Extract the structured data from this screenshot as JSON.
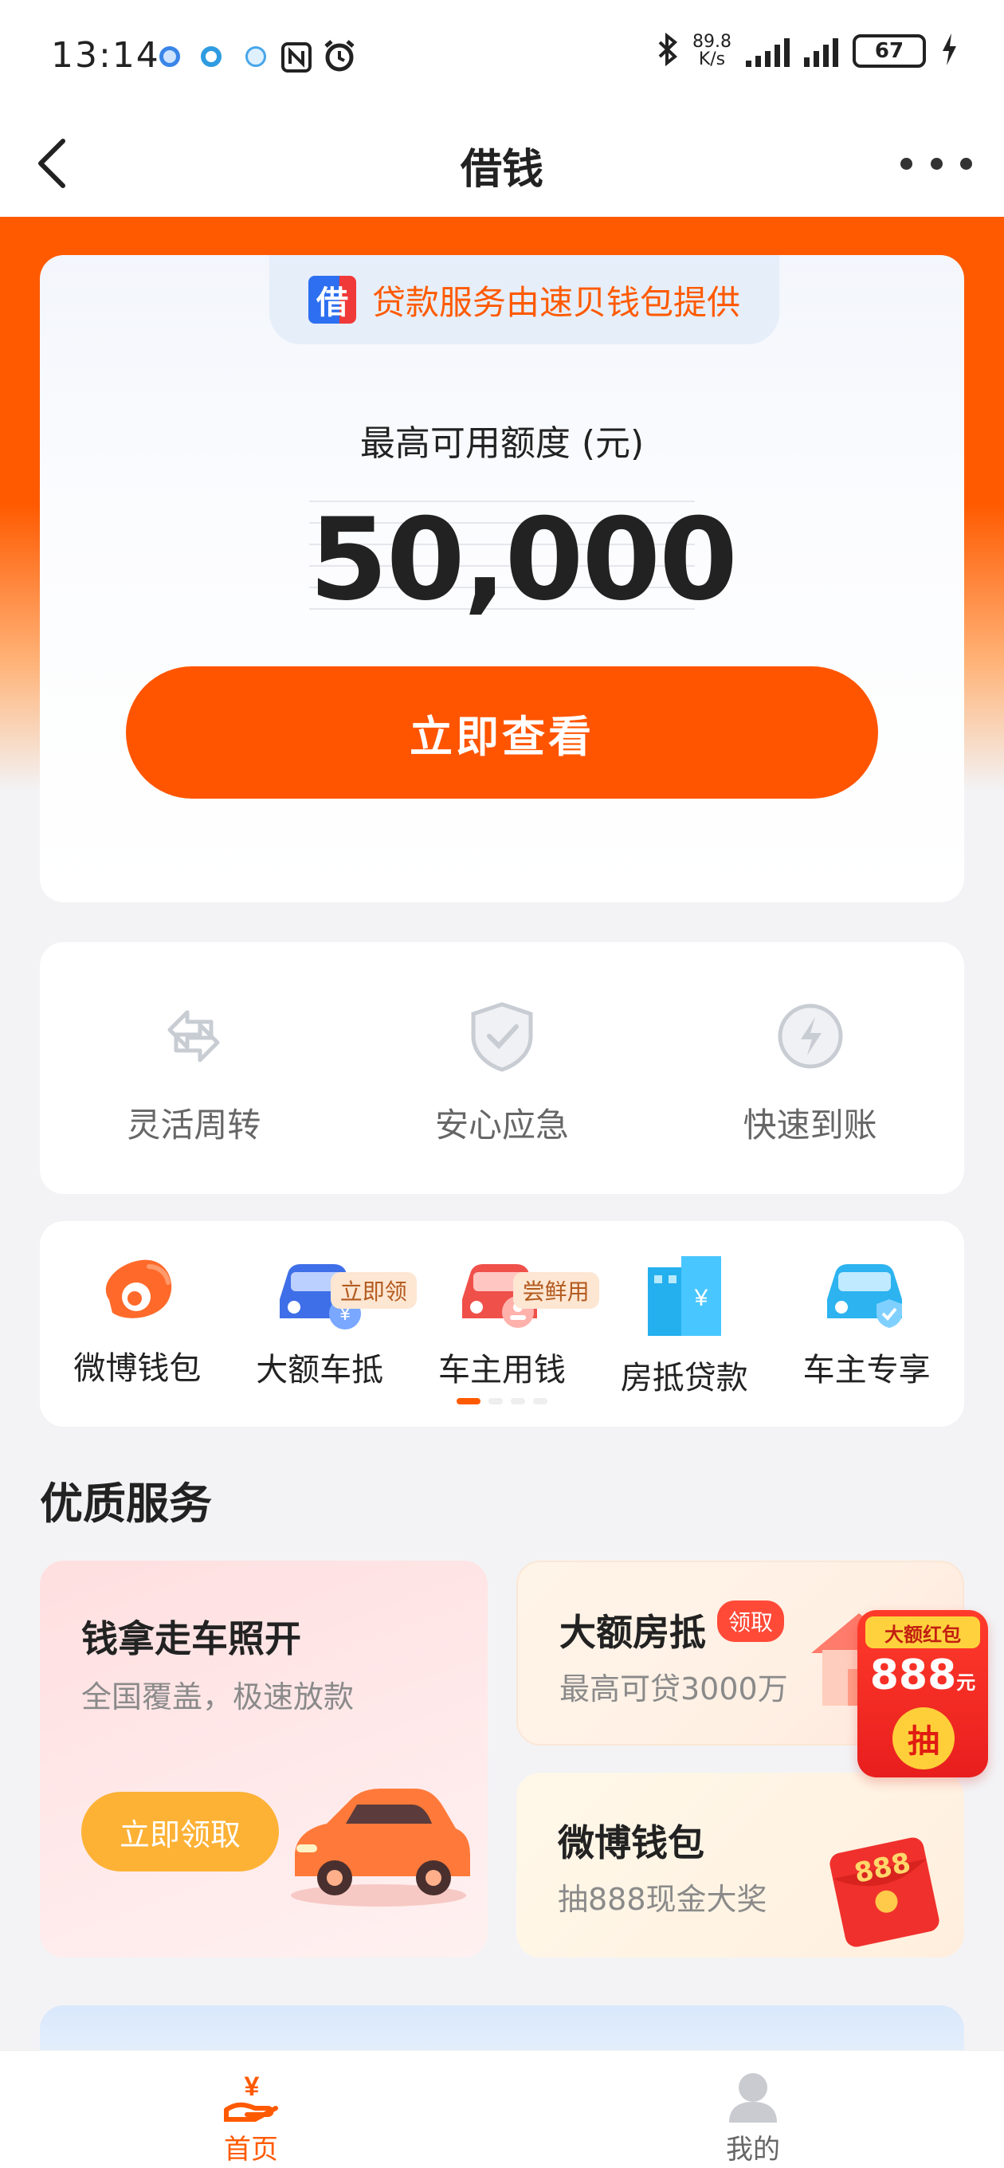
{
  "status_bar": {
    "time": "13:14",
    "net_speed_value": "89.8",
    "net_speed_unit": "K/s",
    "battery": "67"
  },
  "nav": {
    "title": "借钱",
    "back_icon": "chevron-left-icon",
    "more_icon": "more-horizontal-icon"
  },
  "credit": {
    "provider_logo": "借",
    "provider_text": "贷款服务由速贝钱包提供",
    "quota_label": "最高可用额度 (元)",
    "quota_amount": "50,000",
    "cta_label": "立即查看"
  },
  "features": [
    {
      "label": "灵活周转",
      "icon": "swap-arrows-icon"
    },
    {
      "label": "安心应急",
      "icon": "shield-check-icon"
    },
    {
      "label": "快速到账",
      "icon": "lightning-icon"
    }
  ],
  "shortcuts": [
    {
      "label": "微博钱包",
      "icon": "weibo-icon",
      "tag": ""
    },
    {
      "label": "大额车抵",
      "icon": "car-yuan-icon",
      "tag": "立即领"
    },
    {
      "label": "车主用钱",
      "icon": "car-person-icon",
      "tag": "尝鲜用"
    },
    {
      "label": "房抵贷款",
      "icon": "building-yuan-icon",
      "tag": ""
    },
    {
      "label": "车主专享",
      "icon": "car-shield-icon",
      "tag": ""
    }
  ],
  "section": {
    "title": "优质服务"
  },
  "services": {
    "car_loan": {
      "title": "钱拿走车照开",
      "subtitle": "全国覆盖，极速放款",
      "button": "立即领取"
    },
    "house_loan": {
      "title": "大额房抵",
      "badge": "领取",
      "subtitle": "最高可贷3000万"
    },
    "weibo_wallet": {
      "title": "微博钱包",
      "subtitle": "抽888现金大奖",
      "envelope_text": "888"
    }
  },
  "promo": {
    "top": "大额红包",
    "amount": "888",
    "unit": "元",
    "action": "抽"
  },
  "tabbar": {
    "home": "首页",
    "mine": "我的"
  },
  "colors": {
    "brand_orange": "#ff5500",
    "tag_bg": "#fde6d2",
    "gold_button": "#fdb236"
  }
}
